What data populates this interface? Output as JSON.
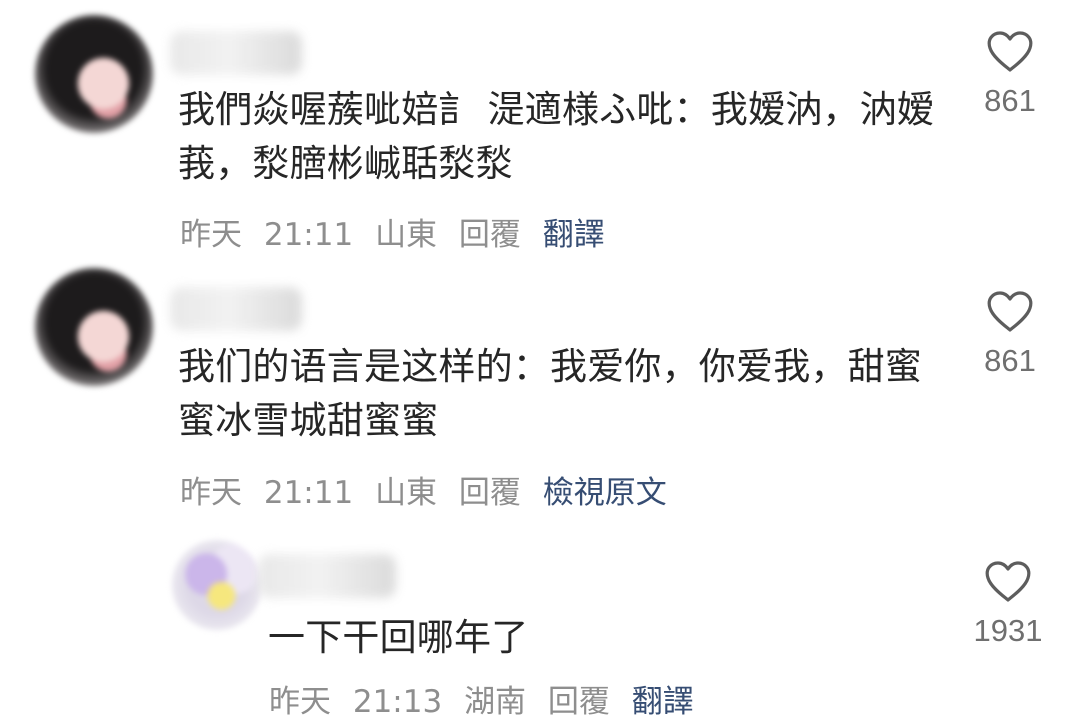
{
  "comments": [
    {
      "text": "我們焱喔蔟呲婄訁 湜適様ふ吡：我嫒汭，汭嫒莪，湬膪彬峸聒湬湬",
      "time": "昨天",
      "clock": "21:11",
      "location": "山東",
      "reply": "回覆",
      "action": "翻譯",
      "likes": "861"
    },
    {
      "text": "我们的语言是这样的：我爱你，你爱我，甜蜜蜜冰雪城甜蜜蜜",
      "time": "昨天",
      "clock": "21:11",
      "location": "山東",
      "reply": "回覆",
      "action": "檢視原文",
      "likes": "861"
    },
    {
      "text": "一下干回哪年了",
      "time": "昨天",
      "clock": "21:13",
      "location": "湖南",
      "reply": "回覆",
      "action": "翻譯",
      "likes": "1931"
    }
  ],
  "icons": {
    "like": "heart-outline-icon"
  }
}
